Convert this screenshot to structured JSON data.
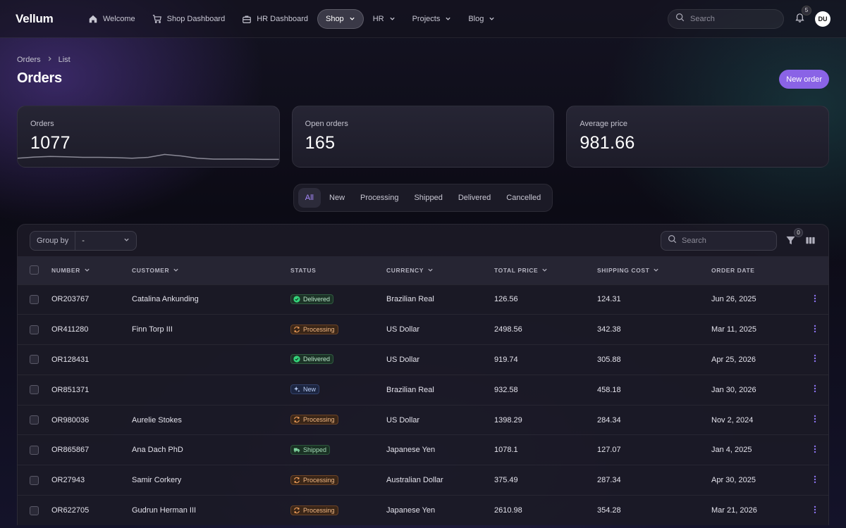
{
  "app": {
    "brand": "Vellum"
  },
  "nav": {
    "items": [
      {
        "label": "Welcome",
        "icon": "home-icon"
      },
      {
        "label": "Shop Dashboard",
        "icon": "cart-icon"
      },
      {
        "label": "HR Dashboard",
        "icon": "briefcase-icon"
      },
      {
        "label": "Shop",
        "active": true,
        "dropdown": true
      },
      {
        "label": "HR",
        "dropdown": true
      },
      {
        "label": "Projects",
        "dropdown": true
      },
      {
        "label": "Blog",
        "dropdown": true
      }
    ],
    "search_placeholder": "Search",
    "notifications_count": "5",
    "user_initials": "DU"
  },
  "header": {
    "breadcrumb": [
      "Orders",
      "List"
    ],
    "title": "Orders",
    "new_order_label": "New order"
  },
  "stats": [
    {
      "label": "Orders",
      "value": "1077",
      "sparkline": [
        3,
        3.4,
        3.6,
        3.5,
        3.3,
        3.3,
        3.2,
        3.0,
        3.3,
        4.3,
        3.8,
        3.0,
        2.7,
        2.7,
        2.7,
        2.6,
        2.6
      ]
    },
    {
      "label": "Open orders",
      "value": "165"
    },
    {
      "label": "Average price",
      "value": "981.66"
    }
  ],
  "tabs": [
    "All",
    "New",
    "Processing",
    "Shipped",
    "Delivered",
    "Cancelled"
  ],
  "active_tab": "All",
  "toolbar": {
    "group_by_label": "Group by",
    "group_by_value": "-",
    "search_placeholder": "Search",
    "filter_count": "0"
  },
  "table": {
    "columns": [
      "Number",
      "Customer",
      "Status",
      "Currency",
      "Total price",
      "Shipping cost",
      "Order date"
    ],
    "rows": [
      {
        "number": "OR203767",
        "customer": "Catalina Ankunding",
        "status": "Delivered",
        "currency": "Brazilian Real",
        "total": "126.56",
        "shipping": "124.31",
        "date": "Jun 26, 2025"
      },
      {
        "number": "OR411280",
        "customer": "Finn Torp III",
        "status": "Processing",
        "currency": "US Dollar",
        "total": "2498.56",
        "shipping": "342.38",
        "date": "Mar 11, 2025"
      },
      {
        "number": "OR128431",
        "customer": "",
        "status": "Delivered",
        "currency": "US Dollar",
        "total": "919.74",
        "shipping": "305.88",
        "date": "Apr 25, 2026"
      },
      {
        "number": "OR851371",
        "customer": "",
        "status": "New",
        "currency": "Brazilian Real",
        "total": "932.58",
        "shipping": "458.18",
        "date": "Jan 30, 2026"
      },
      {
        "number": "OR980036",
        "customer": "Aurelie Stokes",
        "status": "Processing",
        "currency": "US Dollar",
        "total": "1398.29",
        "shipping": "284.34",
        "date": "Nov 2, 2024"
      },
      {
        "number": "OR865867",
        "customer": "Ana Dach PhD",
        "status": "Shipped",
        "currency": "Japanese Yen",
        "total": "1078.1",
        "shipping": "127.07",
        "date": "Jan 4, 2025"
      },
      {
        "number": "OR27943",
        "customer": "Samir Corkery",
        "status": "Processing",
        "currency": "Australian Dollar",
        "total": "375.49",
        "shipping": "287.34",
        "date": "Apr 30, 2025"
      },
      {
        "number": "OR622705",
        "customer": "Gudrun Herman III",
        "status": "Processing",
        "currency": "Japanese Yen",
        "total": "2610.98",
        "shipping": "354.28",
        "date": "Mar 21, 2026"
      }
    ]
  },
  "colors": {
    "accent": "#8a63e6",
    "active_tab_text": "#a88bff",
    "delivered": "#22c55e",
    "processing": "#f97316",
    "new": "#3b82f6",
    "shipped": "#10b981"
  }
}
